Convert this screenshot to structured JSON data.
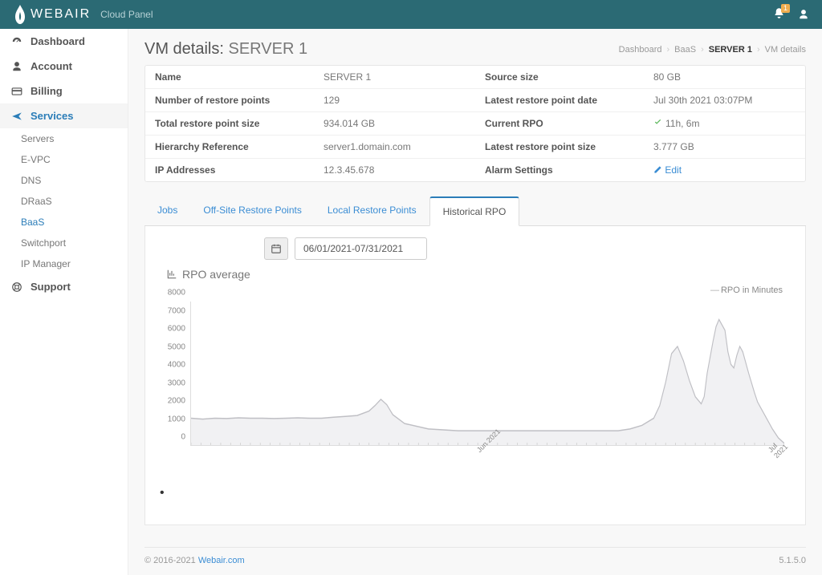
{
  "brand": {
    "name": "WEBAIR",
    "subtitle": "Cloud Panel"
  },
  "topbar": {
    "bell_badge": "1"
  },
  "sidebar": {
    "items": [
      {
        "label": "Dashboard",
        "icon": "dashboard"
      },
      {
        "label": "Account",
        "icon": "user"
      },
      {
        "label": "Billing",
        "icon": "credit"
      },
      {
        "label": "Services",
        "icon": "plane",
        "active": true
      },
      {
        "label": "Support",
        "icon": "life-ring"
      }
    ],
    "services_sub": [
      "Servers",
      "E-VPC",
      "DNS",
      "DRaaS",
      "BaaS",
      "Switchport",
      "IP Manager"
    ],
    "sub_active": "BaaS"
  },
  "page": {
    "title_prefix": "VM details:",
    "server_name": "SERVER 1"
  },
  "breadcrumb": [
    "Dashboard",
    "BaaS",
    "SERVER 1",
    "VM details"
  ],
  "details": {
    "left": [
      {
        "label": "Name",
        "value": "SERVER 1"
      },
      {
        "label": "Number of restore points",
        "value": "129"
      },
      {
        "label": "Total restore point size",
        "value": "934.014 GB"
      },
      {
        "label": "Hierarchy Reference",
        "value": "server1.domain.com"
      },
      {
        "label": "IP Addresses",
        "value": "12.3.45.678"
      }
    ],
    "right": [
      {
        "label": "Source size",
        "value": "80 GB"
      },
      {
        "label": "Latest restore point date",
        "value": "Jul 30th 2021 03:07PM"
      },
      {
        "label": "Current RPO",
        "value": "11h, 6m",
        "check": true
      },
      {
        "label": "Latest restore point size",
        "value": "3.777 GB"
      },
      {
        "label": "Alarm Settings",
        "value": "Edit",
        "link": true,
        "edit_icon": true
      }
    ]
  },
  "tabs": [
    "Jobs",
    "Off-Site Restore Points",
    "Local Restore Points",
    "Historical RPO"
  ],
  "active_tab": "Historical RPO",
  "date_range": "06/01/2021-07/31/2021",
  "chart_title": "RPO average",
  "chart_data": {
    "type": "area",
    "title": "RPO average",
    "legend": "RPO in Minutes",
    "ylabel": "",
    "xlabel": "",
    "ylim": [
      0,
      8000
    ],
    "yticks": [
      0,
      1000,
      2000,
      3000,
      4000,
      5000,
      6000,
      7000,
      8000
    ],
    "x_labels": [
      "Jun 2021",
      "Jul 2021"
    ],
    "x_label_positions": [
      0.48,
      0.97
    ],
    "x": [
      0,
      0.02,
      0.04,
      0.06,
      0.08,
      0.1,
      0.12,
      0.14,
      0.16,
      0.18,
      0.2,
      0.22,
      0.24,
      0.26,
      0.28,
      0.3,
      0.31,
      0.32,
      0.33,
      0.34,
      0.36,
      0.4,
      0.45,
      0.5,
      0.55,
      0.6,
      0.65,
      0.7,
      0.72,
      0.74,
      0.76,
      0.78,
      0.79,
      0.8,
      0.81,
      0.82,
      0.83,
      0.84,
      0.85,
      0.86,
      0.865,
      0.87,
      0.88,
      0.885,
      0.89,
      0.9,
      0.905,
      0.91,
      0.915,
      0.92,
      0.925,
      0.93,
      0.94,
      0.95,
      0.955,
      0.96,
      0.97,
      0.98,
      0.99,
      1.0
    ],
    "values": [
      1500,
      1450,
      1500,
      1480,
      1520,
      1500,
      1500,
      1480,
      1500,
      1520,
      1500,
      1500,
      1550,
      1600,
      1650,
      1900,
      2200,
      2550,
      2250,
      1700,
      1200,
      900,
      800,
      800,
      800,
      800,
      800,
      800,
      800,
      900,
      1100,
      1500,
      2200,
      3500,
      5100,
      5500,
      4700,
      3600,
      2700,
      2300,
      2700,
      4000,
      5800,
      6600,
      7000,
      6400,
      5200,
      4500,
      4300,
      5000,
      5500,
      5200,
      4000,
      2900,
      2400,
      2100,
      1500,
      900,
      400,
      100
    ]
  },
  "footer": {
    "copyright": "© 2016-2021 ",
    "link": "Webair.com",
    "version": "5.1.5.0"
  }
}
